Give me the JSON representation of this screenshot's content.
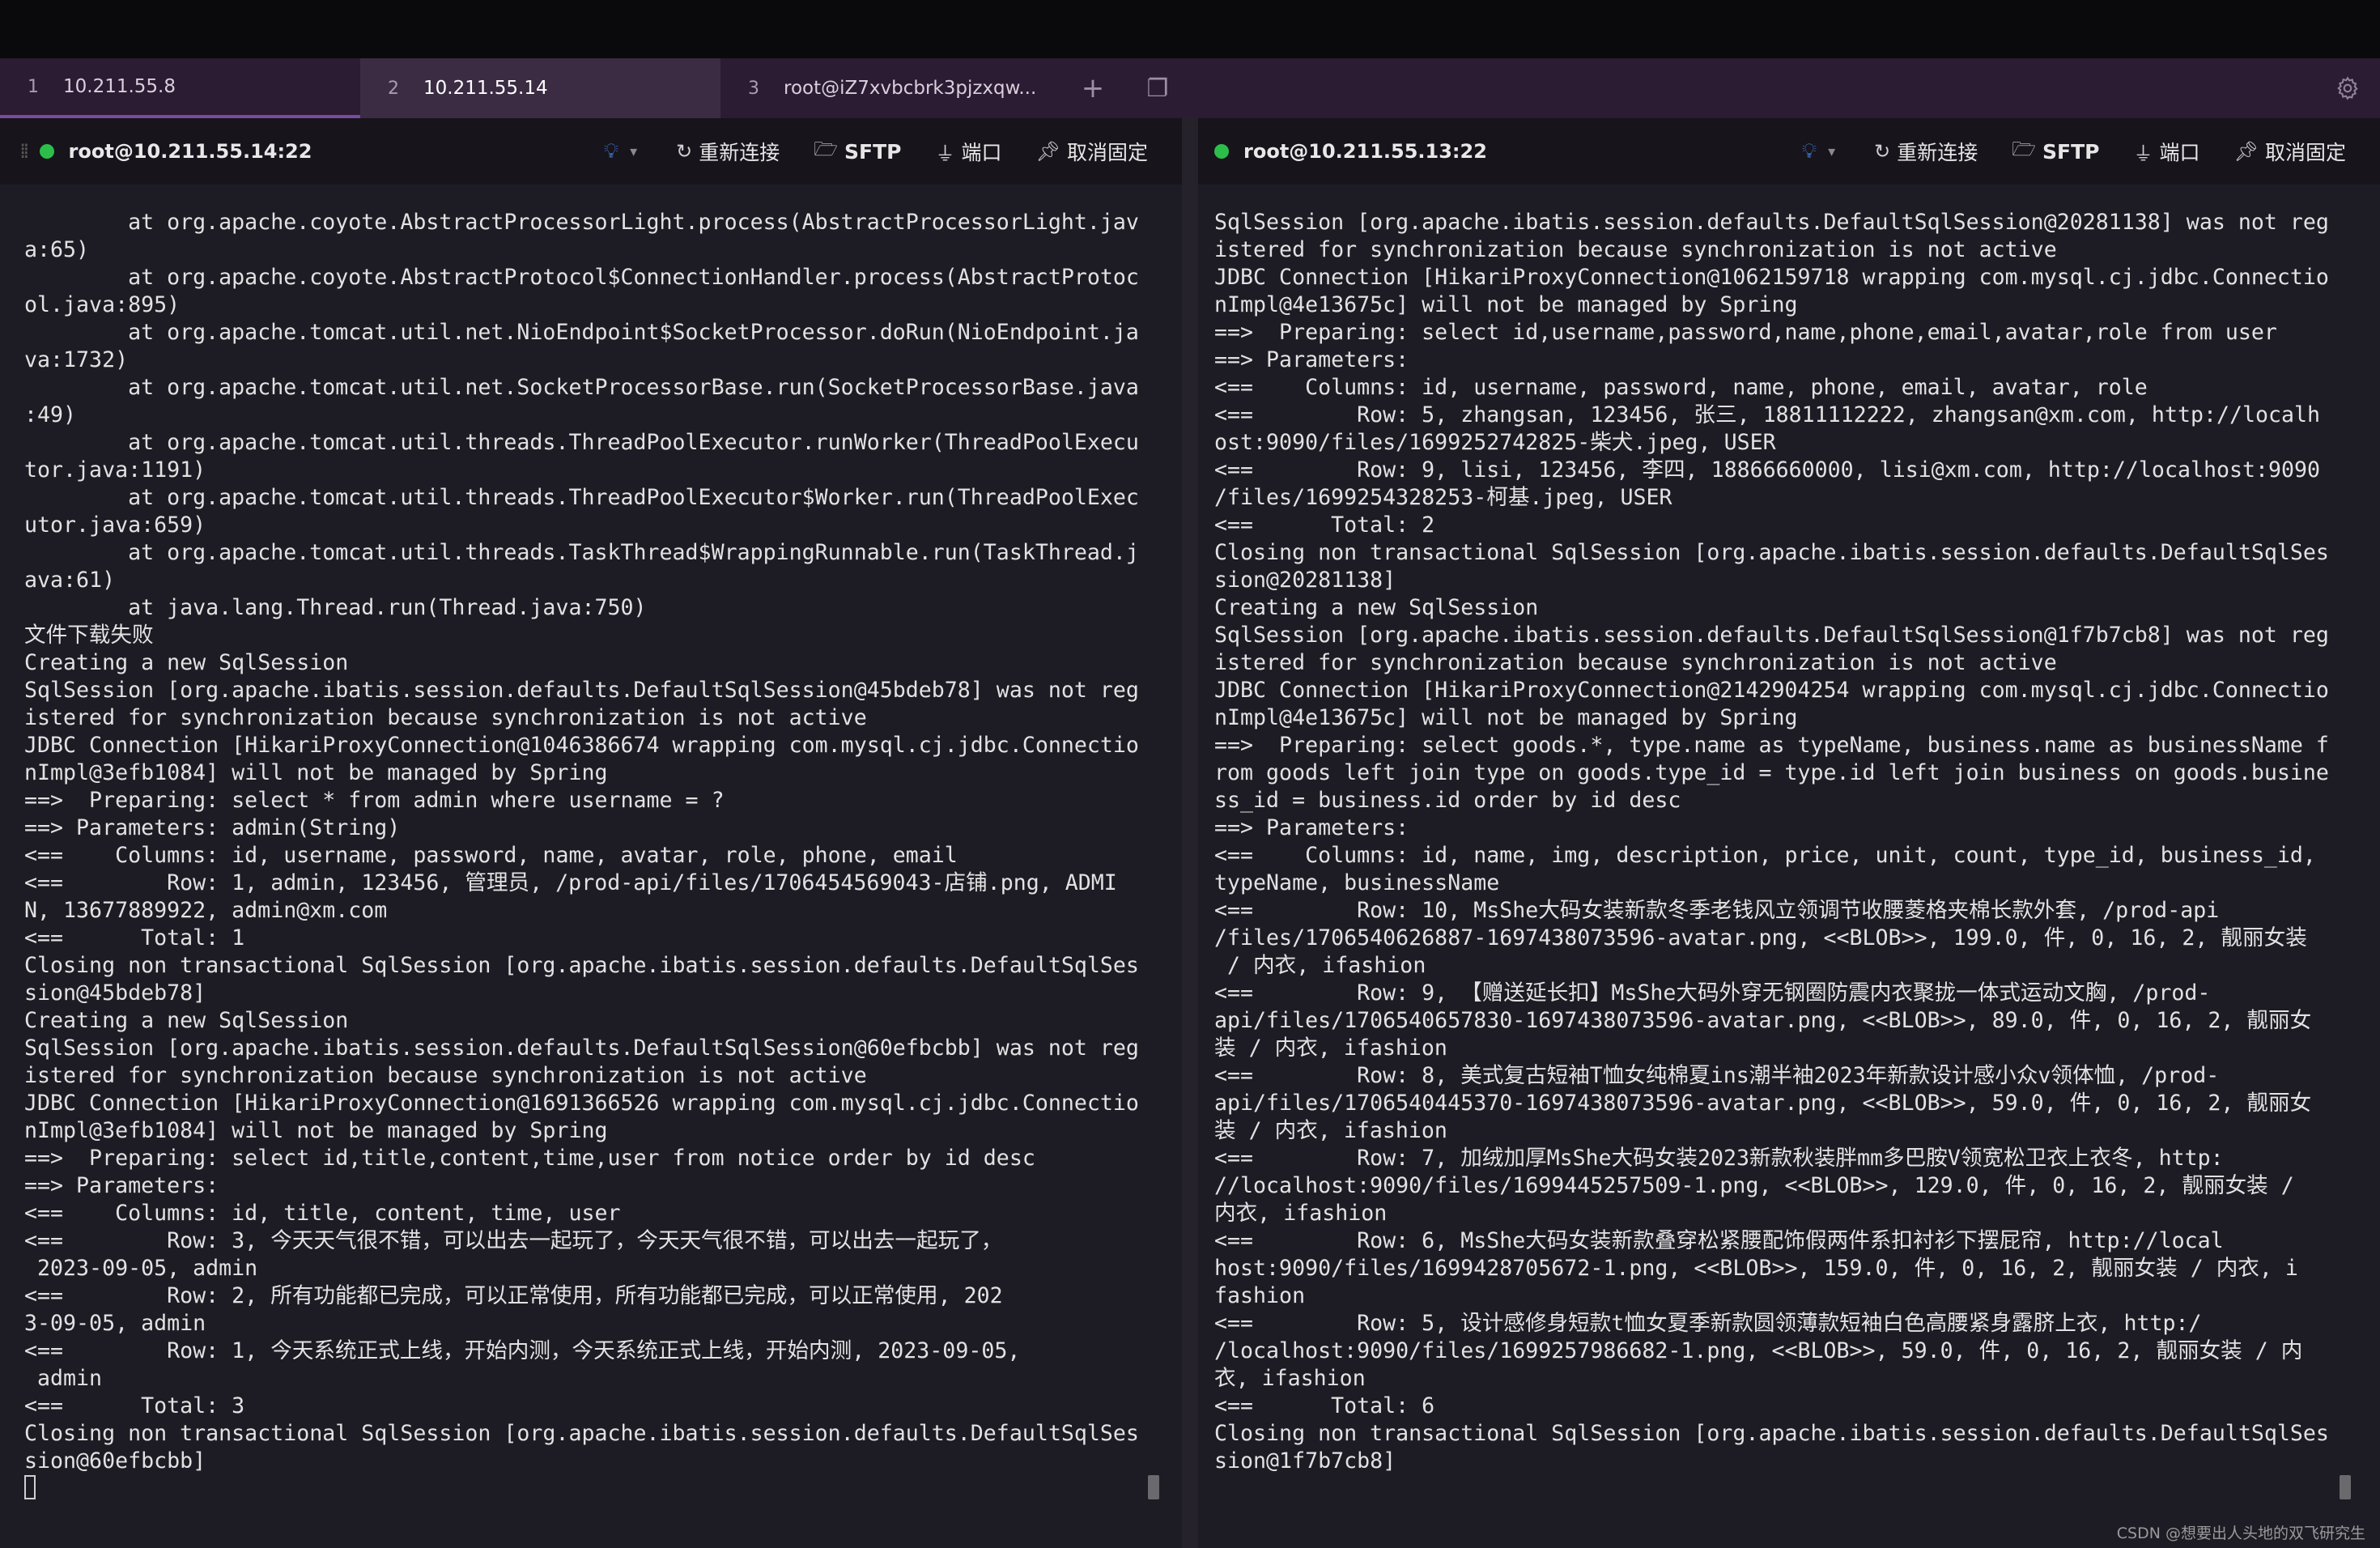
{
  "tabs": [
    {
      "num": "1",
      "label": "10.211.55.8"
    },
    {
      "num": "2",
      "label": "10.211.55.14"
    },
    {
      "num": "3",
      "label": "root@iZ7xvbcbrk3pjzxqw..."
    }
  ],
  "tab_buttons": {
    "add": "+",
    "window": "❐"
  },
  "settings_icon": "gear-icon",
  "left_pane": {
    "host": "root@10.211.55.14:22",
    "tools": {
      "reconnect": "重新连接",
      "sftp": "SFTP",
      "port": "端口",
      "unpin": "取消固定"
    },
    "lines": [
      "        at org.apache.coyote.AbstractProcessorLight.process(AbstractProcessorLight.jav",
      "a:65)",
      "        at org.apache.coyote.AbstractProtocol$ConnectionHandler.process(AbstractProtoc",
      "ol.java:895)",
      "        at org.apache.tomcat.util.net.NioEndpoint$SocketProcessor.doRun(NioEndpoint.ja",
      "va:1732)",
      "        at org.apache.tomcat.util.net.SocketProcessorBase.run(SocketProcessorBase.java",
      ":49)",
      "        at org.apache.tomcat.util.threads.ThreadPoolExecutor.runWorker(ThreadPoolExecu",
      "tor.java:1191)",
      "        at org.apache.tomcat.util.threads.ThreadPoolExecutor$Worker.run(ThreadPoolExec",
      "utor.java:659)",
      "        at org.apache.tomcat.util.threads.TaskThread$WrappingRunnable.run(TaskThread.j",
      "ava:61)",
      "        at java.lang.Thread.run(Thread.java:750)",
      "文件下载失败",
      "Creating a new SqlSession",
      "SqlSession [org.apache.ibatis.session.defaults.DefaultSqlSession@45bdeb78] was not reg",
      "istered for synchronization because synchronization is not active",
      "JDBC Connection [HikariProxyConnection@1046386674 wrapping com.mysql.cj.jdbc.Connectio",
      "nImpl@3efb1084] will not be managed by Spring",
      "==>  Preparing: select * from admin where username = ?",
      "==> Parameters: admin(String)",
      "<==    Columns: id, username, password, name, avatar, role, phone, email",
      "<==        Row: 1, admin, 123456, 管理员, /prod-api/files/1706454569043-店铺.png, ADMI",
      "N, 13677889922, admin@xm.com",
      "<==      Total: 1",
      "Closing non transactional SqlSession [org.apache.ibatis.session.defaults.DefaultSqlSes",
      "sion@45bdeb78]",
      "Creating a new SqlSession",
      "SqlSession [org.apache.ibatis.session.defaults.DefaultSqlSession@60efbcbb] was not reg",
      "istered for synchronization because synchronization is not active",
      "JDBC Connection [HikariProxyConnection@1691366526 wrapping com.mysql.cj.jdbc.Connectio",
      "nImpl@3efb1084] will not be managed by Spring",
      "==>  Preparing: select id,title,content,time,user from notice order by id desc",
      "==> Parameters: ",
      "<==    Columns: id, title, content, time, user",
      "<==        Row: 3, 今天天气很不错，可以出去一起玩了，今天天气很不错，可以出去一起玩了，",
      " 2023-09-05, admin",
      "<==        Row: 2, 所有功能都已完成，可以正常使用，所有功能都已完成，可以正常使用, 202",
      "3-09-05, admin",
      "<==        Row: 1, 今天系统正式上线，开始内测，今天系统正式上线，开始内测, 2023-09-05,",
      " admin",
      "<==      Total: 3",
      "Closing non transactional SqlSession [org.apache.ibatis.session.defaults.DefaultSqlSes",
      "sion@60efbcbb]"
    ]
  },
  "right_pane": {
    "host": "root@10.211.55.13:22",
    "tools": {
      "reconnect": "重新连接",
      "sftp": "SFTP",
      "port": "端口",
      "unpin": "取消固定"
    },
    "lines": [
      "SqlSession [org.apache.ibatis.session.defaults.DefaultSqlSession@20281138] was not reg",
      "istered for synchronization because synchronization is not active",
      "JDBC Connection [HikariProxyConnection@1062159718 wrapping com.mysql.cj.jdbc.Connectio",
      "nImpl@4e13675c] will not be managed by Spring",
      "==>  Preparing: select id,username,password,name,phone,email,avatar,role from user",
      "==> Parameters: ",
      "<==    Columns: id, username, password, name, phone, email, avatar, role",
      "<==        Row: 5, zhangsan, 123456, 张三, 18811112222, zhangsan@xm.com, http://localh",
      "ost:9090/files/1699252742825-柴犬.jpeg, USER",
      "<==        Row: 9, lisi, 123456, 李四, 18866660000, lisi@xm.com, http://localhost:9090",
      "/files/1699254328253-柯基.jpeg, USER",
      "<==      Total: 2",
      "Closing non transactional SqlSession [org.apache.ibatis.session.defaults.DefaultSqlSes",
      "sion@20281138]",
      "Creating a new SqlSession",
      "SqlSession [org.apache.ibatis.session.defaults.DefaultSqlSession@1f7b7cb8] was not reg",
      "istered for synchronization because synchronization is not active",
      "JDBC Connection [HikariProxyConnection@2142904254 wrapping com.mysql.cj.jdbc.Connectio",
      "nImpl@4e13675c] will not be managed by Spring",
      "==>  Preparing: select goods.*, type.name as typeName, business.name as businessName f",
      "rom goods left join type on goods.type_id = type.id left join business on goods.busine",
      "ss_id = business.id order by id desc",
      "==> Parameters: ",
      "<==    Columns: id, name, img, description, price, unit, count, type_id, business_id,",
      "typeName, businessName",
      "<==        Row: 10, MsShe大码女装新款冬季老钱风立领调节收腰菱格夹棉长款外套, /prod-api",
      "/files/1706540626887-1697438073596-avatar.png, <<BLOB>>, 199.0, 件, 0, 16, 2, 靓丽女装",
      " / 内衣, ifashion",
      "<==        Row: 9, 【赠送延长扣】MsShe大码外穿无钢圈防震内衣聚拢一体式运动文胸, /prod-",
      "api/files/1706540657830-1697438073596-avatar.png, <<BLOB>>, 89.0, 件, 0, 16, 2, 靓丽女",
      "装 / 内衣, ifashion",
      "<==        Row: 8, 美式复古短袖T恤女纯棉夏ins潮半袖2023年新款设计感小众v领体恤, /prod-",
      "api/files/1706540445370-1697438073596-avatar.png, <<BLOB>>, 59.0, 件, 0, 16, 2, 靓丽女",
      "装 / 内衣, ifashion",
      "<==        Row: 7, 加绒加厚MsShe大码女装2023新款秋装胖mm多巴胺V领宽松卫衣上衣冬, http:",
      "//localhost:9090/files/1699445257509-1.png, <<BLOB>>, 129.0, 件, 0, 16, 2, 靓丽女装 /",
      "内衣, ifashion",
      "<==        Row: 6, MsShe大码女装新款叠穿松紧腰配饰假两件系扣衬衫下摆屁帘, http://local",
      "host:9090/files/1699428705672-1.png, <<BLOB>>, 159.0, 件, 0, 16, 2, 靓丽女装 / 内衣, i",
      "fashion",
      "<==        Row: 5, 设计感修身短款t恤女夏季新款圆领薄款短袖白色高腰紧身露脐上衣, http:/",
      "/localhost:9090/files/1699257986682-1.png, <<BLOB>>, 59.0, 件, 0, 16, 2, 靓丽女装 / 内",
      "衣, ifashion",
      "<==      Total: 6",
      "Closing non transactional SqlSession [org.apache.ibatis.session.defaults.DefaultSqlSes",
      "sion@1f7b7cb8]"
    ]
  },
  "watermark": "CSDN @想要出人头地的双飞研究生",
  "colors": {
    "tab_bar": "#2b1b33",
    "active_tab": "#3b2c44",
    "terminal_bg": "#1d1b24",
    "status_dot": "#2bbf4a",
    "bulb": "#4a8ff0"
  }
}
